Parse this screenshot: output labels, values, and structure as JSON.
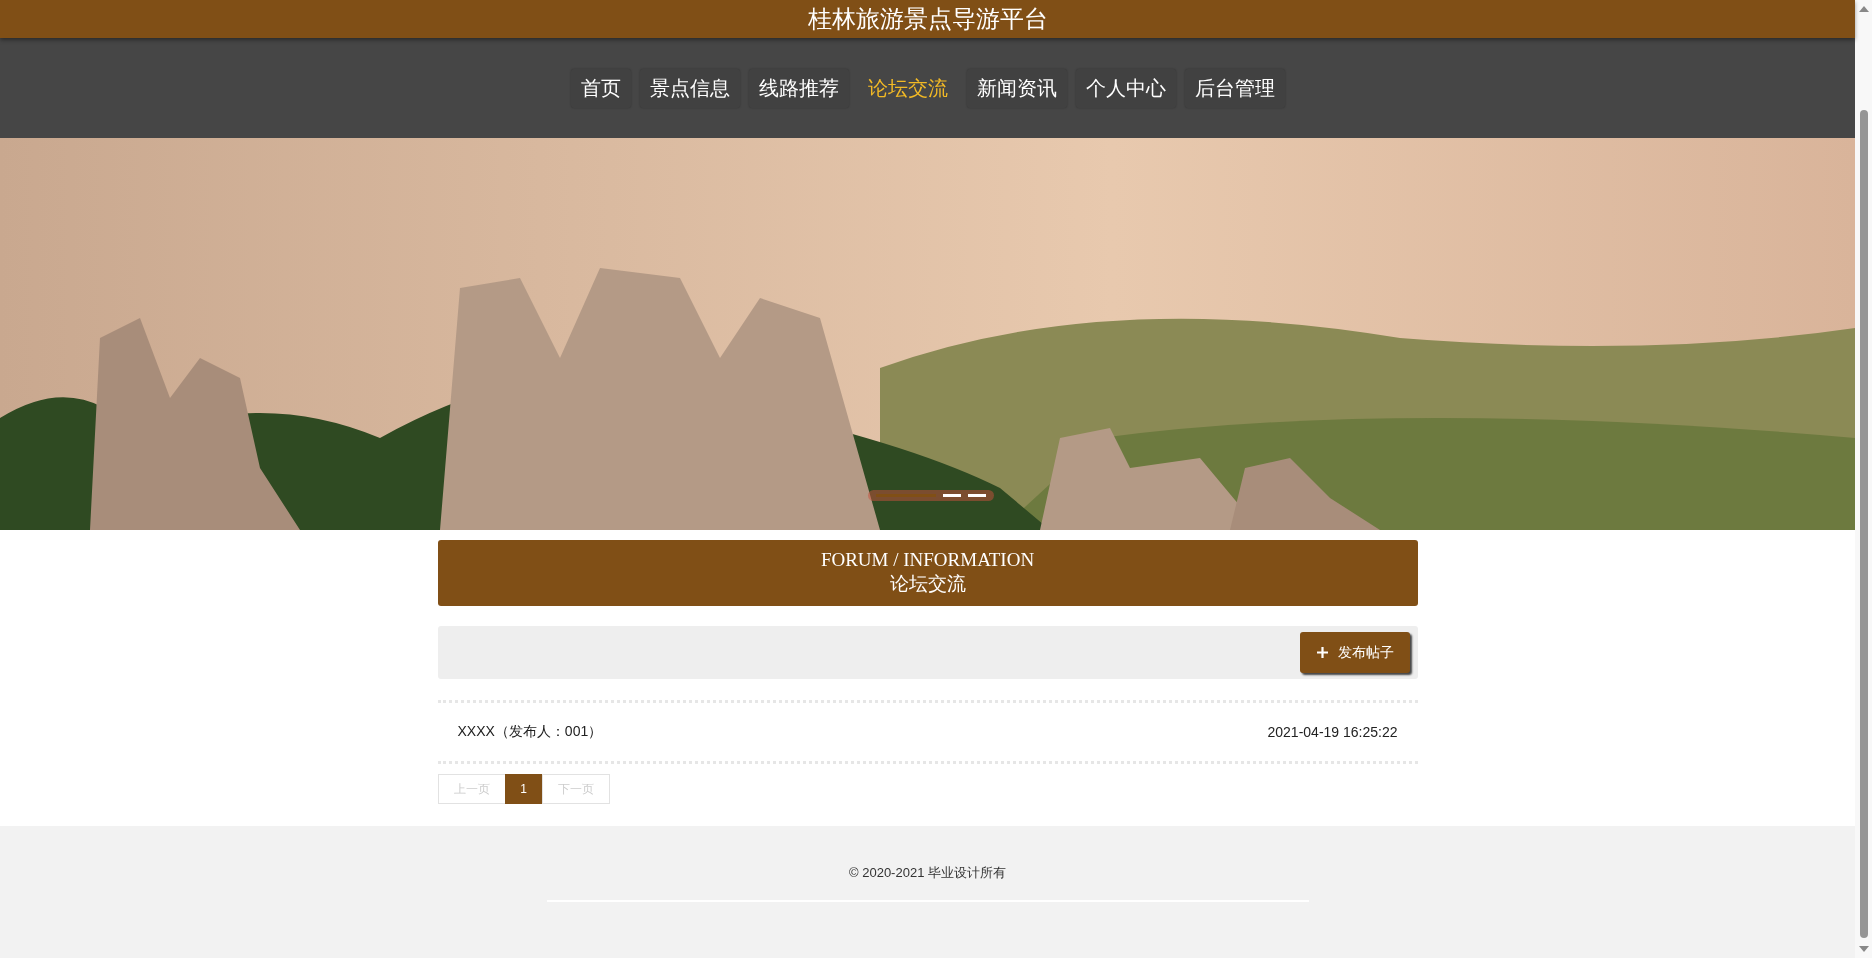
{
  "header": {
    "title": "桂林旅游景点导游平台"
  },
  "nav": [
    {
      "label": "首页",
      "selected": false
    },
    {
      "label": "景点信息",
      "selected": false
    },
    {
      "label": "线路推荐",
      "selected": false
    },
    {
      "label": "论坛交流",
      "selected": true
    },
    {
      "label": "新闻资讯",
      "selected": false
    },
    {
      "label": "个人中心",
      "selected": false
    },
    {
      "label": "后台管理",
      "selected": false
    }
  ],
  "banner": {
    "indicators": [
      {
        "selected": true
      },
      {
        "selected": false
      },
      {
        "selected": false
      }
    ]
  },
  "section": {
    "title_en": "FORUM / INFORMATION",
    "title_cn": "论坛交流"
  },
  "toolbar": {
    "button": "发布帖子"
  },
  "posts": [
    {
      "title": "XXXX（发布人：001）",
      "time": "2021-04-19 16:25:22"
    }
  ],
  "pagination": [
    {
      "label": "上一页",
      "kind": "prev",
      "selected": false
    },
    {
      "label": "1",
      "kind": "page",
      "selected": true
    },
    {
      "label": "下一页",
      "kind": "next",
      "selected": false
    }
  ],
  "footer": {
    "copyright": "© 2020-2021 毕业设计所有"
  }
}
